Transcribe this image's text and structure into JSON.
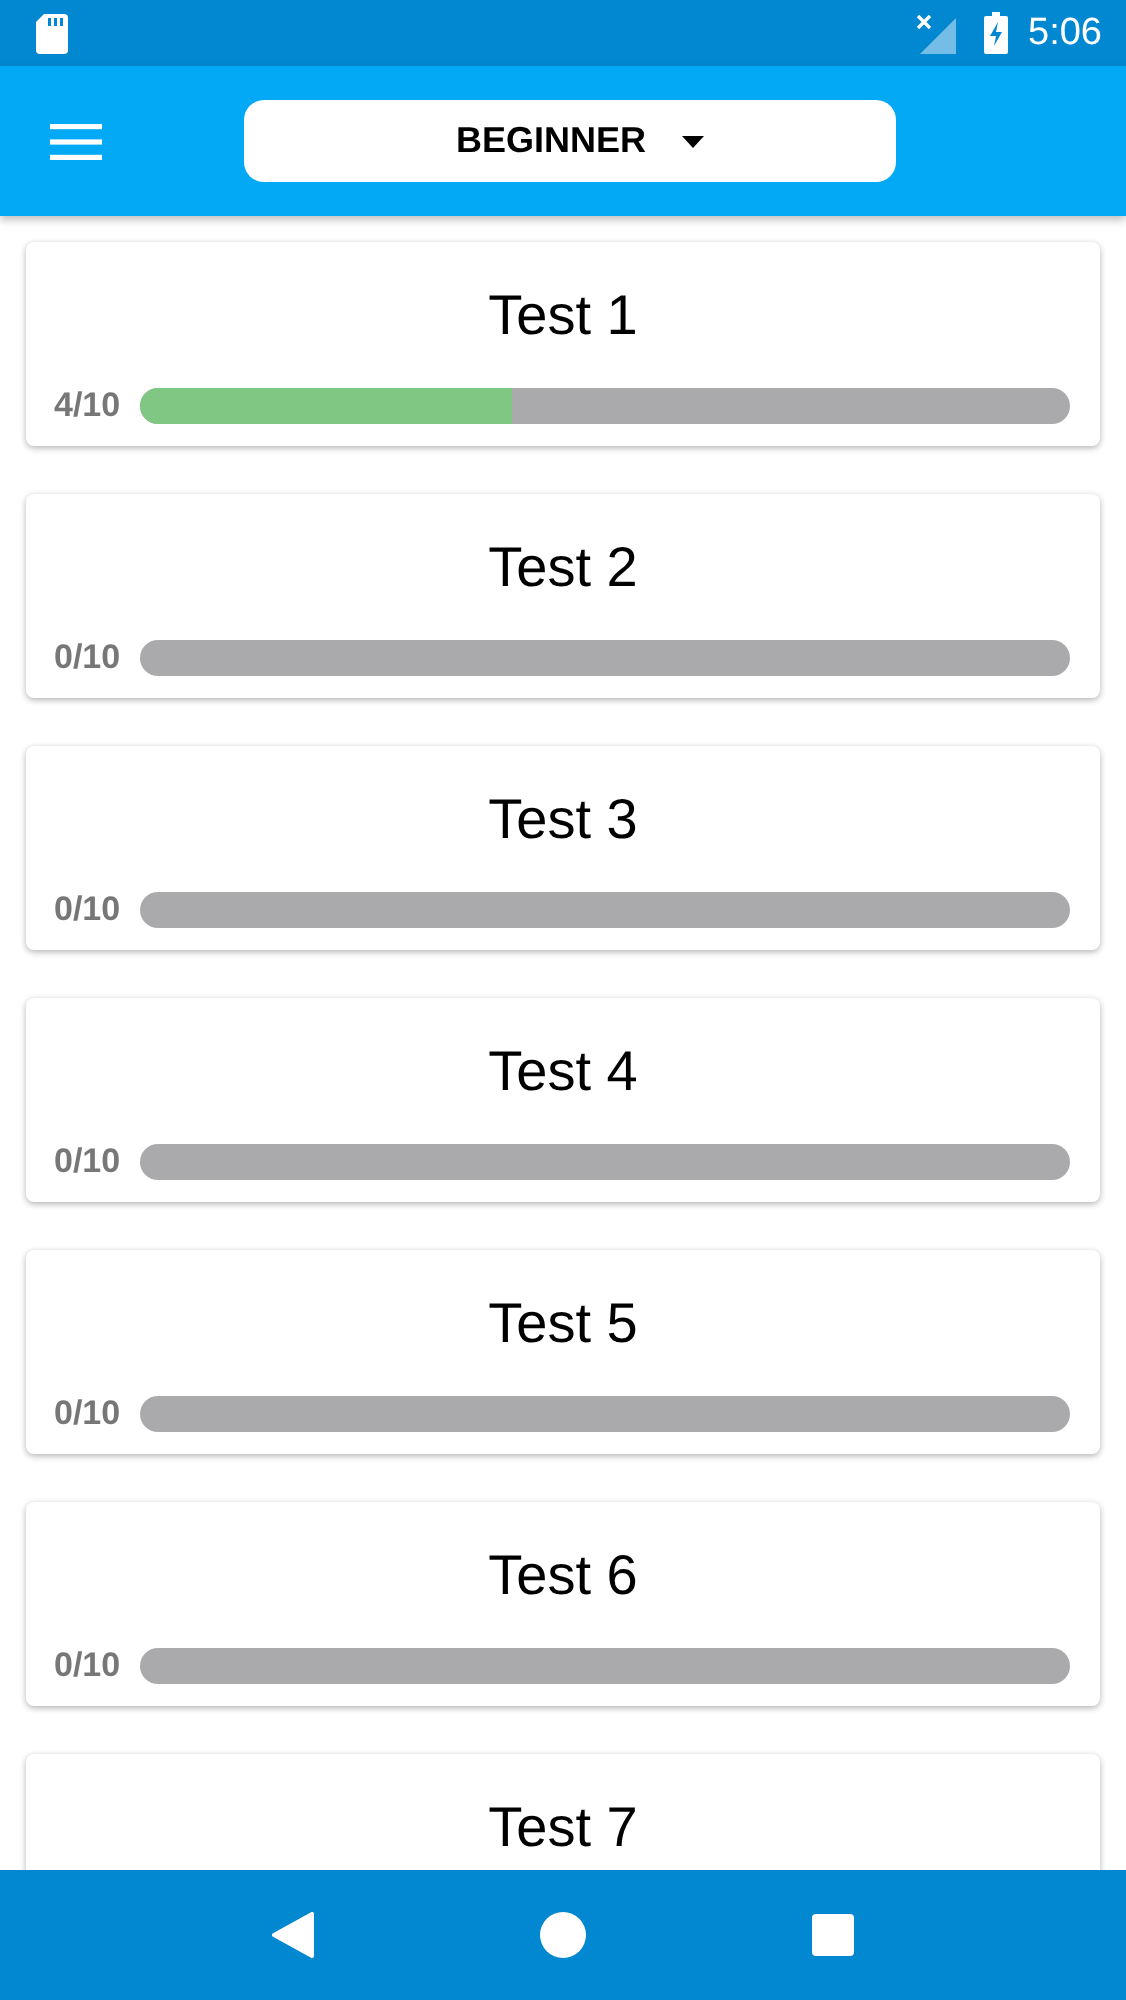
{
  "status_bar": {
    "time": "5:06"
  },
  "app_bar": {
    "level_dropdown": "BEGINNER"
  },
  "tests": [
    {
      "title": "Test 1",
      "score": "4/10",
      "level": 0.4
    },
    {
      "title": "Test 2",
      "score": "0/10",
      "level": 0
    },
    {
      "title": "Test 3",
      "score": "0/10",
      "level": 0
    },
    {
      "title": "Test 4",
      "score": "0/10",
      "level": 0
    },
    {
      "title": "Test 5",
      "score": "0/10",
      "level": 0
    },
    {
      "title": "Test 6",
      "score": "0/10",
      "level": 0
    },
    {
      "title": "Test 7"
    }
  ]
}
